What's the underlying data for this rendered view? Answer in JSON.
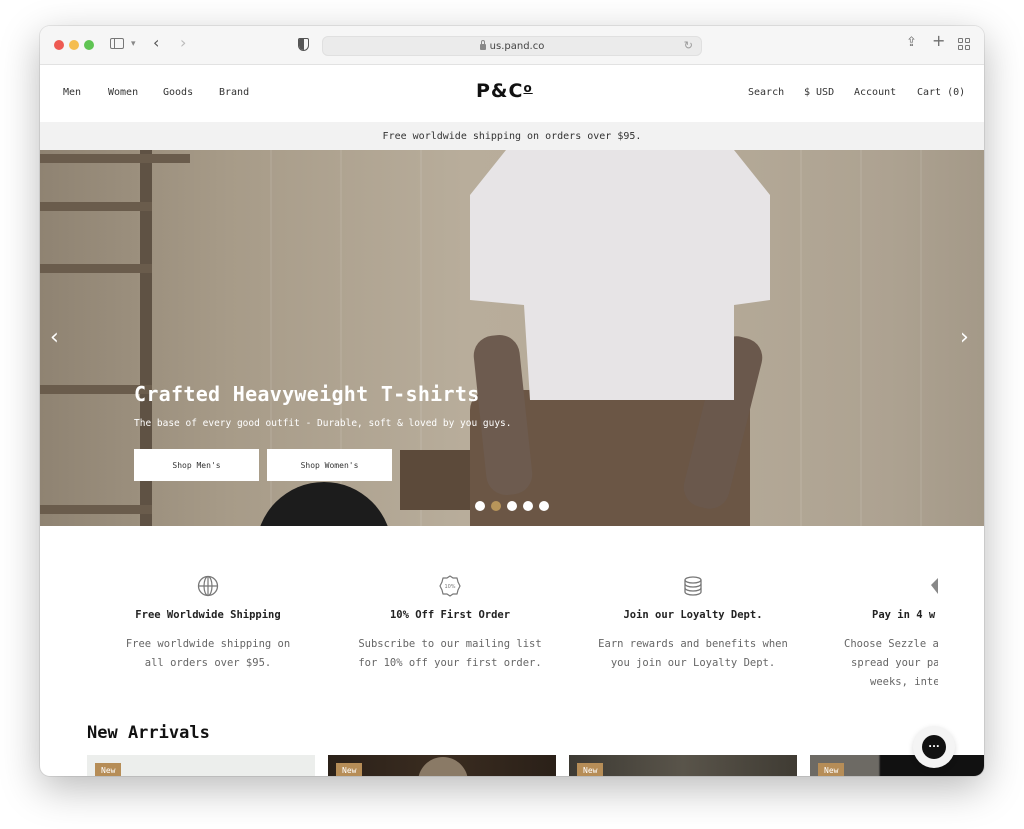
{
  "browser": {
    "url": "us.pand.co"
  },
  "header": {
    "nav_left": [
      "Men",
      "Women",
      "Goods",
      "Brand"
    ],
    "logo": "P&C",
    "logo_suffix": "o",
    "nav_right": [
      "Search",
      "$ USD",
      "Account",
      "Cart (0)"
    ]
  },
  "announcement": "Free worldwide shipping on orders over $95.",
  "hero": {
    "title": "Crafted Heavyweight T-shirts",
    "subtitle": "The base of every good outfit - Durable, soft & loved by you guys.",
    "buttons": [
      "Shop Men's",
      "Shop Women's"
    ],
    "prev_arrow": "‹",
    "next_arrow": "›",
    "slides_total": 5,
    "active_slide": 2,
    "accent_color": "#b8955a"
  },
  "features": [
    {
      "icon": "globe-icon",
      "title": "Free Worldwide Shipping",
      "text": [
        "Free worldwide shipping on",
        "all orders over $95."
      ]
    },
    {
      "icon": "discount-badge-icon",
      "icon_text": "10%",
      "title": "10% Off First Order",
      "text": [
        "Subscribe to our mailing list",
        "for 10% off your first order."
      ]
    },
    {
      "icon": "coin-stack-icon",
      "title": "Join our Loyalty Dept.",
      "text": [
        "Earn rewards and benefits when",
        "you join our Loyalty Dept."
      ]
    },
    {
      "icon": "sezzle-icon",
      "title": "Pay in 4 w",
      "text": [
        "Choose Sezzle a",
        "spread your pa",
        "weeks, inte"
      ]
    }
  ],
  "new_arrivals": {
    "title": "New Arrivals",
    "badge": "New",
    "badge_color": "#b68d57",
    "count_visible": 4
  },
  "chat": {
    "icon": "chat-icon",
    "label": "..."
  }
}
